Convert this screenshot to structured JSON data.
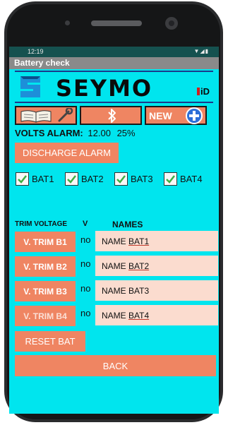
{
  "status": {
    "time": "12:19"
  },
  "app": {
    "title": "Battery check"
  },
  "logo": {
    "brand": "SEYMO",
    "badge": "iD"
  },
  "toolbar": {
    "new_label": "NEW"
  },
  "volts": {
    "label": "VOLTS ALARM:",
    "value": "12.00",
    "percent": "25%"
  },
  "discharge": {
    "label": "DISCHARGE ALARM"
  },
  "batteries": [
    {
      "label": "BAT1",
      "checked": true
    },
    {
      "label": "BAT2",
      "checked": true
    },
    {
      "label": "BAT3",
      "checked": true
    },
    {
      "label": "BAT4",
      "checked": true
    }
  ],
  "headers": {
    "trim": "TRIM VOLTAGE",
    "v": "V",
    "names": "NAMES"
  },
  "trims": [
    {
      "label": "V. TRIM B1",
      "v": "no",
      "name_prefix": "NAME",
      "name_value": "BAT1"
    },
    {
      "label": "V. TRIM B2",
      "v": "no",
      "name_prefix": "NAME",
      "name_value": "BAT2"
    },
    {
      "label": "V. TRIM B3",
      "v": "no",
      "name_prefix": "NAME",
      "name_value": "BAT3"
    },
    {
      "label": "V. TRIM B4",
      "v": "no",
      "name_prefix": "NAME",
      "name_value": "BAT4"
    }
  ],
  "reset": {
    "label": "RESET BAT"
  },
  "back": {
    "label": "BACK"
  },
  "colors": {
    "background": "#00e5ee",
    "button": "#ef8562",
    "field": "#fbdccf",
    "brand_blue": "#1c3a8a"
  },
  "icons": [
    "signal-icon",
    "wifi-icon",
    "battery-status-icon",
    "book-icon",
    "wrench-icon",
    "bluetooth-icon",
    "plus-circle-icon",
    "checkmark-icon"
  ]
}
